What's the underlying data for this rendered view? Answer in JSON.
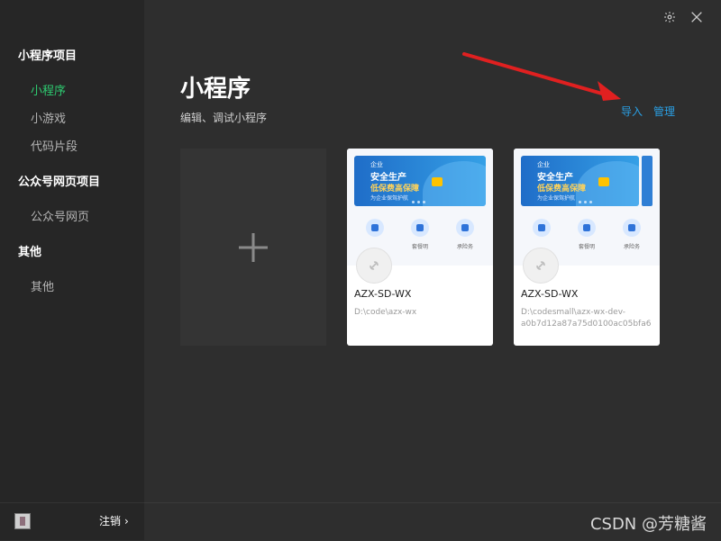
{
  "sidebar": {
    "groups": [
      {
        "label": "小程序项目",
        "items": [
          "小程序",
          "小游戏",
          "代码片段"
        ]
      },
      {
        "label": "公众号网页项目",
        "items": [
          "公众号网页"
        ]
      },
      {
        "label": "其他",
        "items": [
          "其他"
        ]
      }
    ],
    "active_item": "小程序",
    "logout_label": "注销",
    "logout_chevron": "›"
  },
  "header": {
    "title": "小程序",
    "subtitle": "编辑、调试小程序",
    "import_label": "导入",
    "manage_label": "管理"
  },
  "projects": [
    {
      "name": "AZX-SD-WX",
      "path": "D:\\code\\azx-wx",
      "banner": {
        "line1": "企业",
        "line2": "安全生产",
        "line3": "低保费高保障",
        "line4": "为企业保驾护航"
      },
      "services": [
        "",
        "套餐明",
        "承险务"
      ]
    },
    {
      "name": "AZX-SD-WX",
      "path": "D:\\codesmall\\azx-wx-dev-a0b7d12a87a75d0100ac05bfa6",
      "banner": {
        "line1": "企业",
        "line2": "安全生产",
        "line3": "低保费高保障",
        "line4": "为企业保驾护航"
      },
      "services": [
        "",
        "套餐明",
        "承险务"
      ]
    }
  ],
  "watermark": "CSDN @芳糖酱",
  "colors": {
    "background": "#2e2e2e",
    "sidebar": "#262626",
    "active": "#2ecc71",
    "link": "#2aa0e5",
    "annotation_arrow": "#e02020"
  },
  "icons": {
    "settings": "gear-icon",
    "close": "close-icon",
    "add": "plus-icon",
    "project_logo": "link-icon"
  }
}
